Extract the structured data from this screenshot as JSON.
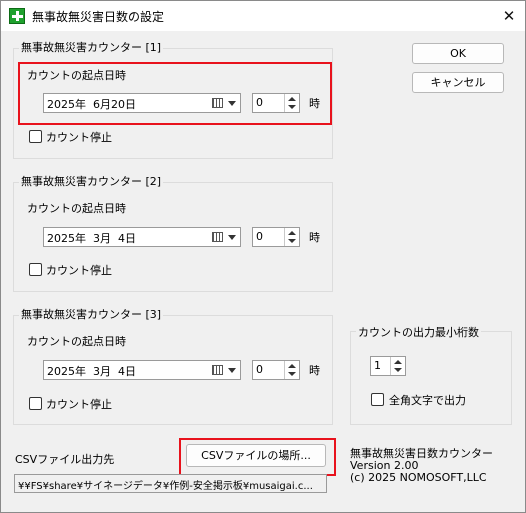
{
  "window": {
    "title": "無事故無災害日数の設定",
    "close_label": "✕"
  },
  "counters": [
    {
      "group_title": "無事故無災害カウンター [1]",
      "start_label": "カウントの起点日時",
      "date": "2025年  6月20日",
      "hour": "0",
      "hour_unit": "時",
      "stop_label": "カウント停止",
      "stop_checked": false
    },
    {
      "group_title": "無事故無災害カウンター [2]",
      "start_label": "カウントの起点日時",
      "date": "2025年  3月  4日",
      "hour": "0",
      "hour_unit": "時",
      "stop_label": "カウント停止",
      "stop_checked": false
    },
    {
      "group_title": "無事故無災害カウンター [3]",
      "start_label": "カウントの起点日時",
      "date": "2025年  3月  4日",
      "hour": "0",
      "hour_unit": "時",
      "stop_label": "カウント停止",
      "stop_checked": false
    }
  ],
  "buttons": {
    "ok": "OK",
    "cancel": "キャンセル",
    "csv_location": "CSVファイルの場所..."
  },
  "digits_group": {
    "title": "カウントの出力最小桁数",
    "value": "1",
    "fullwidth_label": "全角文字で出力",
    "fullwidth_checked": false
  },
  "csv": {
    "label": "CSVファイル出力先",
    "path": "¥¥FS¥share¥サイネージデータ¥作例-安全掲示板¥musaigai.c..."
  },
  "info": {
    "app_name": "無事故無災害日数カウンター",
    "version": "Version 2.00",
    "copyright": "(c) 2025 NOMOSOFT,LLC"
  },
  "colors": {
    "highlight": "#e8121c",
    "title_icon": "#1fa12e"
  }
}
